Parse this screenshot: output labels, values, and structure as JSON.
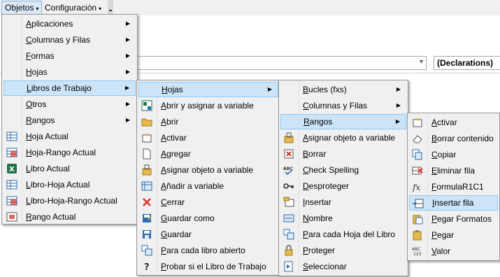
{
  "toolbar": {
    "objetos_label": "Objetos",
    "config_label": "Configuración"
  },
  "code_window": {
    "procedure_combo": "(Declarations)"
  },
  "menu1": {
    "items": [
      {
        "label": "Aplicaciones",
        "icon": "none"
      },
      {
        "label": "Columnas y Filas",
        "icon": "none"
      },
      {
        "label": "Formas",
        "icon": "none"
      },
      {
        "label": "Hojas",
        "icon": "none"
      },
      {
        "label": "Libros de Trabajo",
        "icon": "none"
      },
      {
        "label": "Otros",
        "icon": "none"
      },
      {
        "label": "Rangos",
        "icon": "none"
      },
      {
        "label": "Hoja Actual",
        "icon": "sheet-icon"
      },
      {
        "label": "Hoja-Rango Actual",
        "icon": "sheet-range-icon"
      },
      {
        "label": "Libro Actual",
        "icon": "excel-icon"
      },
      {
        "label": "Libro-Hoja Actual",
        "icon": "sheet-icon"
      },
      {
        "label": "Libro-Hoja-Rango Actual",
        "icon": "sheet-range-icon"
      },
      {
        "label": "Rango Actual",
        "icon": "range-icon"
      }
    ]
  },
  "menu2": {
    "items": [
      {
        "label": "Hojas",
        "icon": "none"
      },
      {
        "label": "Abrir y asignar a variable",
        "icon": "open-assign-icon"
      },
      {
        "label": "Abrir",
        "icon": "folder-icon"
      },
      {
        "label": "Activar",
        "icon": "activate-icon"
      },
      {
        "label": "Agregar",
        "icon": "new-page-icon"
      },
      {
        "label": "Asignar objeto a variable",
        "icon": "assign-icon"
      },
      {
        "label": "Añadir a variable",
        "icon": "add-variable-icon"
      },
      {
        "label": "Cerrar",
        "icon": "close-icon"
      },
      {
        "label": "Guardar como",
        "icon": "save-as-icon"
      },
      {
        "label": "Guardar",
        "icon": "save-icon"
      },
      {
        "label": "Para cada libro abierto",
        "icon": "loop-icon"
      },
      {
        "label": "Probar si el Libro de Trabajo",
        "icon": "question-icon"
      }
    ]
  },
  "menu3": {
    "items": [
      {
        "label": "Bucles (fxs)",
        "icon": "none"
      },
      {
        "label": "Columnas y Filas",
        "icon": "none"
      },
      {
        "label": "Rangos",
        "icon": "none"
      },
      {
        "label": "Asignar objeto a variable",
        "icon": "assign-icon"
      },
      {
        "label": "Borrar",
        "icon": "delete-icon"
      },
      {
        "label": "Check Spelling",
        "icon": "spelling-icon"
      },
      {
        "label": "Desproteger",
        "icon": "key-icon"
      },
      {
        "label": "Insertar",
        "icon": "insert-icon"
      },
      {
        "label": "Nombre",
        "icon": "name-icon"
      },
      {
        "label": "Para cada Hoja del Libro",
        "icon": "loop-icon"
      },
      {
        "label": "Proteger",
        "icon": "lock-icon"
      },
      {
        "label": "Seleccionar",
        "icon": "select-icon"
      }
    ]
  },
  "menu4": {
    "items": [
      {
        "label": "Activar",
        "icon": "activate-icon"
      },
      {
        "label": "Borrar contenido",
        "icon": "eraser-icon"
      },
      {
        "label": "Copiar",
        "icon": "copy-icon"
      },
      {
        "label": "Eliminar fila",
        "icon": "delete-row-icon"
      },
      {
        "label": "FormulaR1C1",
        "icon": "fx-icon"
      },
      {
        "label": "Insertar fila",
        "icon": "insert-row-icon"
      },
      {
        "label": "Pegar Formatos",
        "icon": "paste-format-icon"
      },
      {
        "label": "Pegar",
        "icon": "paste-icon"
      },
      {
        "label": "Valor",
        "icon": "value-icon"
      }
    ]
  },
  "colors": {
    "highlight": "#cce4f7",
    "highlight_border": "#90c8f6",
    "menu_bg": "#f0f0f0",
    "accent_green": "#217346",
    "accent_red": "#d9342b",
    "accent_blue": "#2b6cb0"
  }
}
